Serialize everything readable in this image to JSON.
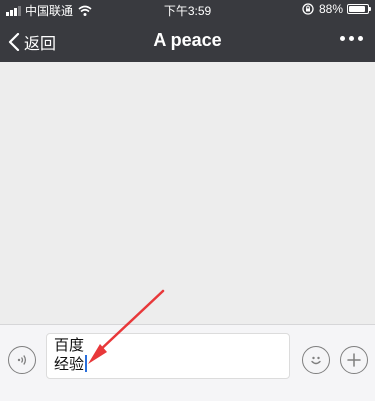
{
  "status_bar": {
    "carrier": "中国联通",
    "time": "下午3:59",
    "battery_percent_label": "88%",
    "battery_level": 0.88
  },
  "nav": {
    "back_label": "返回",
    "title": "A peace",
    "more_icon": "more-dots-icon"
  },
  "input": {
    "line1": "百度",
    "line2": "经验"
  },
  "icons": {
    "voice": "voice-icon",
    "emoji": "emoji-icon",
    "plus": "plus-icon"
  },
  "colors": {
    "header_bg": "#393a3f",
    "chat_bg": "#ededed",
    "annotation_arrow": "#e8383a",
    "caret": "#2a6fdb"
  }
}
